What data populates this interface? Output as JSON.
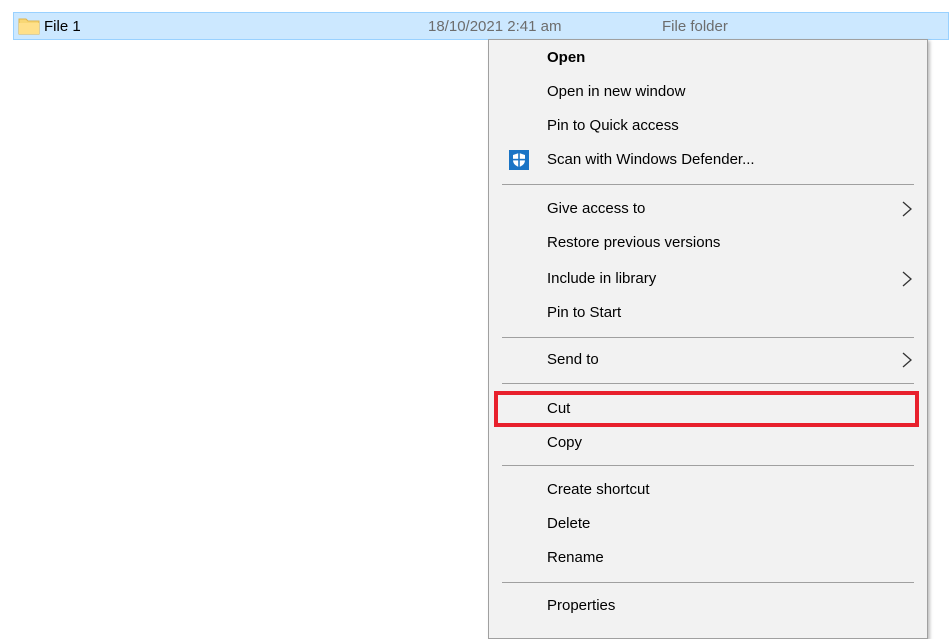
{
  "file_row": {
    "name": "File 1",
    "date": "18/10/2021 2:41 am",
    "type": "File folder",
    "icon": "folder-icon"
  },
  "context_menu": {
    "items": [
      {
        "label": "Open",
        "bold": true
      },
      {
        "label": "Open in new window"
      },
      {
        "label": "Pin to Quick access"
      },
      {
        "label": "Scan with Windows Defender...",
        "icon": "windows-defender-icon"
      },
      {
        "label": "Give access to",
        "submenu": true
      },
      {
        "label": "Restore previous versions"
      },
      {
        "label": "Include in library",
        "submenu": true
      },
      {
        "label": "Pin to Start"
      },
      {
        "label": "Send to",
        "submenu": true
      },
      {
        "label": "Cut",
        "highlighted": true
      },
      {
        "label": "Copy"
      },
      {
        "label": "Create shortcut"
      },
      {
        "label": "Delete"
      },
      {
        "label": "Rename"
      },
      {
        "label": "Properties"
      }
    ]
  },
  "colors": {
    "selection_bg": "#cce8ff",
    "menu_bg": "#f2f2f2",
    "highlight_outline": "#e8202c",
    "defender_blue": "#1a74c5"
  }
}
